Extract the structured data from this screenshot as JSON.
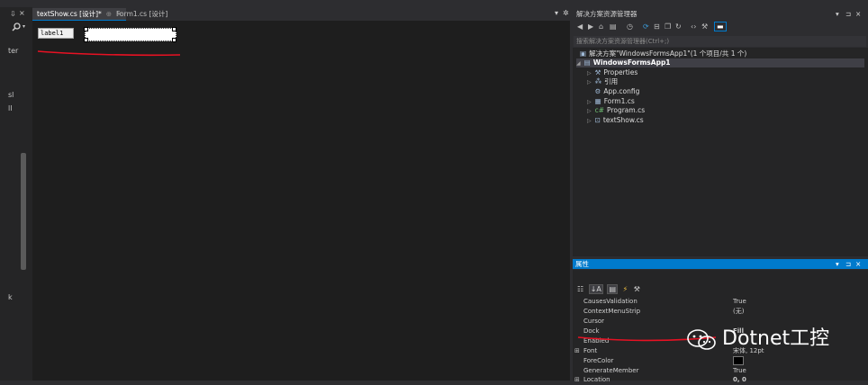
{
  "left_strip": {
    "pin": "⇩",
    "close": "×",
    "search_icon": "magnifier",
    "text1": "ter",
    "text2": "sl",
    "text3": "ll",
    "text4": "k"
  },
  "tabs": [
    {
      "label": "textShow.cs [设计]*",
      "close": "×",
      "pin": "⊕"
    },
    {
      "label": "Form1.cs [设计]"
    }
  ],
  "tab_dropdown": "▾",
  "tab_gear": "✲",
  "designer": {
    "label_text": "label1"
  },
  "solution_explorer": {
    "title": "解决方案资源管理器",
    "header_buttons": [
      "▾",
      "⊐",
      "×"
    ],
    "search_placeholder": "搜索解决方案资源管理器(Ctrl+;)",
    "solution": "解决方案\"WindowsFormsApp1\"(1 个项目/共 1 个)",
    "project": "WindowsFormsApp1",
    "items": [
      "Properties",
      "引用",
      "App.config",
      "Form1.cs",
      "Program.cs",
      "textShow.cs"
    ]
  },
  "properties": {
    "title": "属性",
    "header_buttons": [
      "▾",
      "⊐",
      "×"
    ],
    "rows": [
      {
        "name": "CausesValidation",
        "value": "True"
      },
      {
        "name": "ContextMenuStrip",
        "value": "(无)"
      },
      {
        "name": "Cursor",
        "value": ""
      },
      {
        "name": "Dock",
        "value": "Fill"
      },
      {
        "name": "Enabled",
        "value": ""
      },
      {
        "name": "Font",
        "value": "宋体, 12pt",
        "expand": "⊞"
      },
      {
        "name": "ForeColor",
        "value": ""
      },
      {
        "name": "GenerateMember",
        "value": "True"
      },
      {
        "name": "Location",
        "value": "0, 0",
        "expand": "⊞"
      }
    ]
  },
  "watermark": {
    "text": "Dotnet工控"
  },
  "colors": {
    "accent": "#007acc",
    "annotation_red": "#e81123"
  }
}
